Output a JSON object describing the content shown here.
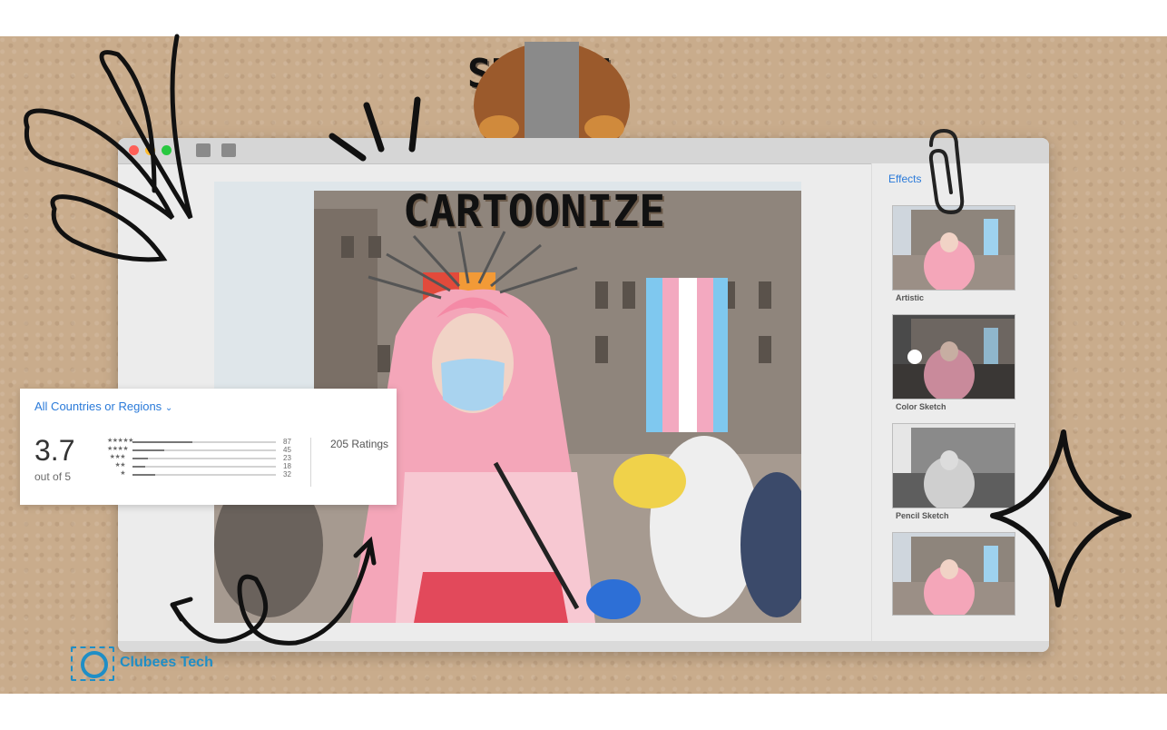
{
  "poster": {
    "title_line1": "SKETCH",
    "title_line2": "N",
    "title_line3": "CARTOONIZE",
    "brand_name": "Clubees Tech"
  },
  "window": {
    "traffic_lights": [
      "#fe5f57",
      "#febc2e",
      "#28c840"
    ],
    "toolbar_icons": [
      "new-folder-icon",
      "export-icon"
    ]
  },
  "sidebar": {
    "title": "Effects",
    "effects": [
      {
        "label": "Artistic",
        "style": "color"
      },
      {
        "label": "Color Sketch",
        "style": "dark"
      },
      {
        "label": "Pencil Sketch",
        "style": "gray"
      },
      {
        "label": "",
        "style": "color"
      }
    ]
  },
  "ratings": {
    "region_label": "All Countries or Regions",
    "average": "3.7",
    "out_of": "out of 5",
    "total_label": "205 Ratings",
    "rows": [
      {
        "stars": "★★★★★",
        "count": "87",
        "fraction": 0.42
      },
      {
        "stars": "★★★★",
        "count": "45",
        "fraction": 0.22
      },
      {
        "stars": "★★★",
        "count": "23",
        "fraction": 0.11
      },
      {
        "stars": "★★",
        "count": "18",
        "fraction": 0.09
      },
      {
        "stars": "★",
        "count": "32",
        "fraction": 0.16
      }
    ]
  },
  "colors": {
    "accent": "#2a7ad9",
    "brand": "#1f8ec6",
    "kraft": "#c9ac8c"
  }
}
